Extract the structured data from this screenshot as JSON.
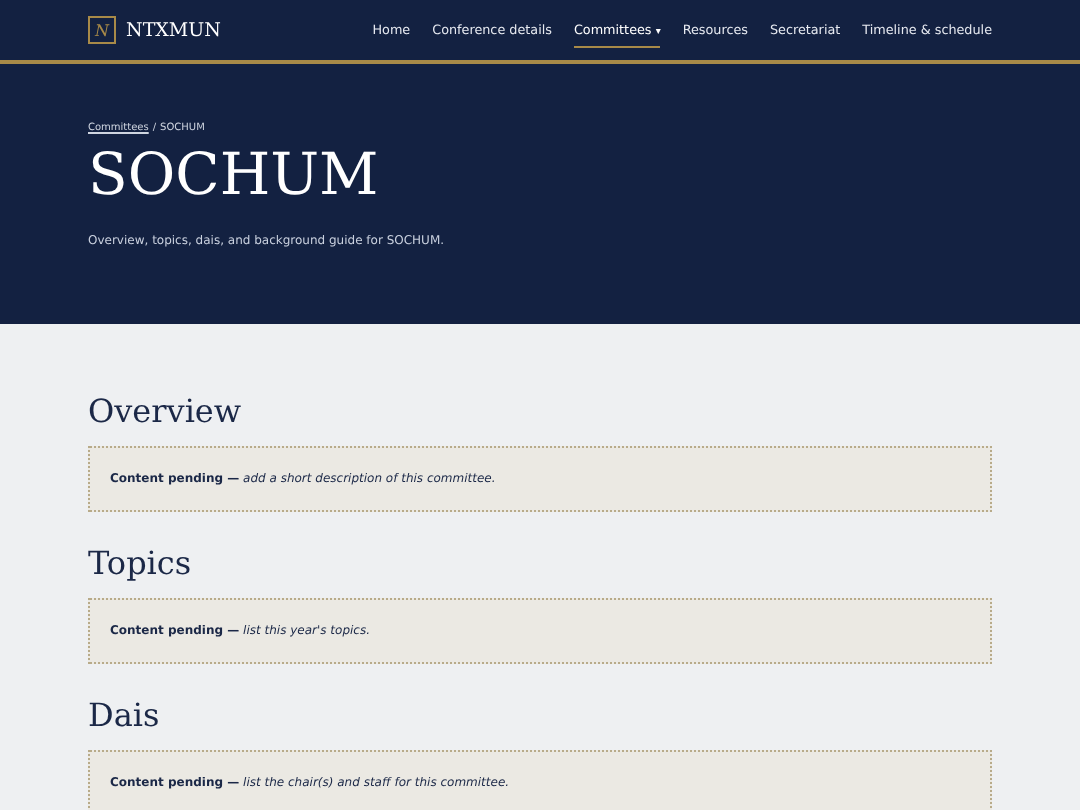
{
  "header": {
    "logo_mark": "N",
    "site_name": "NTXMUN",
    "nav": [
      {
        "label": "Home",
        "selected": false
      },
      {
        "label": "Conference details",
        "selected": false
      },
      {
        "label": "Committees",
        "caret": "▾",
        "selected": true
      },
      {
        "label": "Resources",
        "selected": false
      },
      {
        "label": "Secretariat",
        "selected": false
      },
      {
        "label": "Timeline & schedule",
        "selected": false
      }
    ]
  },
  "hero": {
    "breadcrumb": [
      {
        "label": "Committees",
        "link": true
      },
      {
        "label": "/",
        "link": false
      },
      {
        "label": "SOCHUM",
        "link": false
      }
    ],
    "title": "SOCHUM",
    "description": "Overview, topics, dais, and background guide for SOCHUM."
  },
  "sections": [
    {
      "heading": "Overview",
      "note": "**Content pending —** *add a short description of this committee.*"
    },
    {
      "heading": "Topics",
      "note": "**Content pending —** *list this year's topics.*"
    },
    {
      "heading": "Dais",
      "note": "**Content pending —** *list the chair(s) and staff for this committee.*"
    }
  ]
}
